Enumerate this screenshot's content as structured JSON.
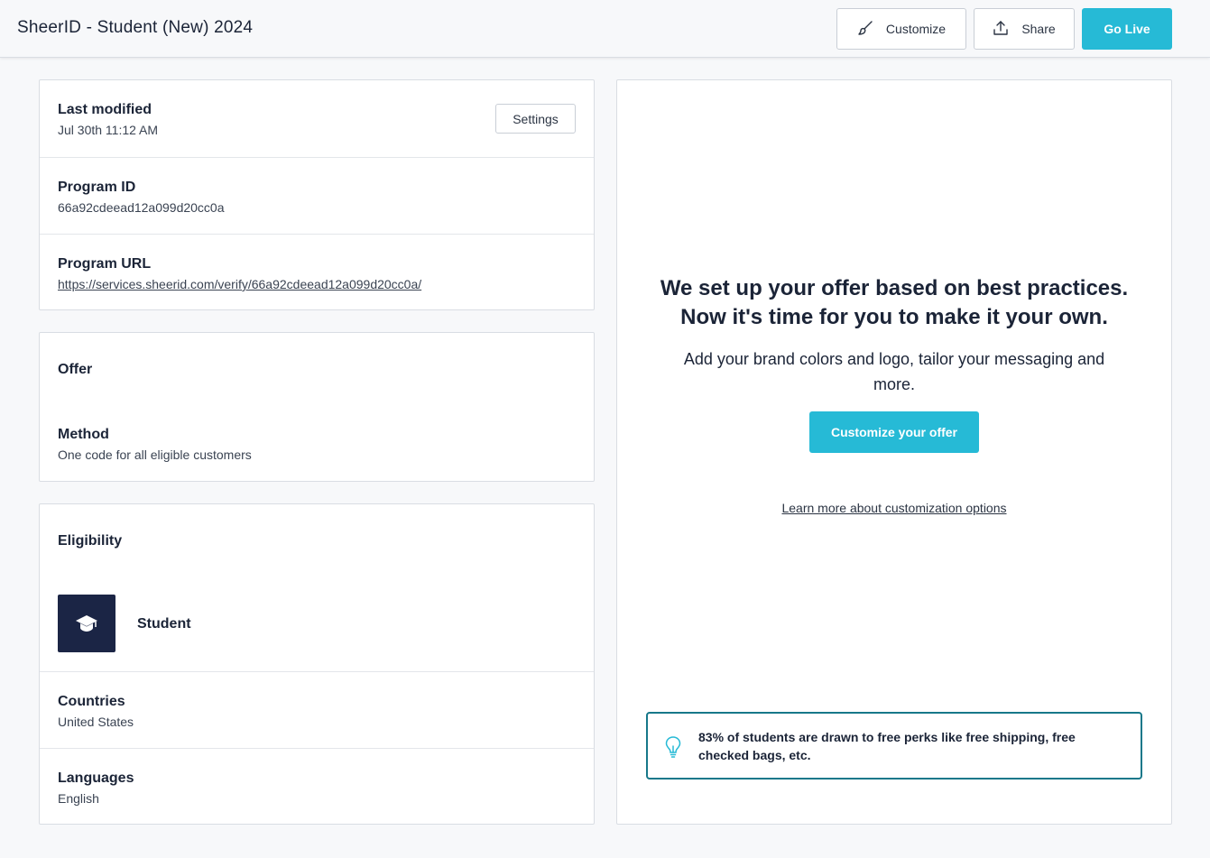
{
  "header": {
    "title": "SheerID - Student (New) 2024",
    "customize_label": "Customize",
    "share_label": "Share",
    "go_live_label": "Go Live"
  },
  "program": {
    "last_modified_label": "Last modified",
    "last_modified_value": "Jul 30th 11:12 AM",
    "settings_label": "Settings",
    "program_id_label": "Program ID",
    "program_id_value": "66a92cdeead12a099d20cc0a",
    "program_url_label": "Program URL",
    "program_url_value": "https://services.sheerid.com/verify/66a92cdeead12a099d20cc0a/"
  },
  "offer": {
    "title": "Offer",
    "method_label": "Method",
    "method_value": "One code for all eligible customers"
  },
  "eligibility": {
    "title": "Eligibility",
    "segment_label": "Student",
    "countries_label": "Countries",
    "countries_value": "United States",
    "languages_label": "Languages",
    "languages_value": "English"
  },
  "preview": {
    "headline_line1": "We set up your offer based on best practices.",
    "headline_line2": "Now it's time for you to make it your own.",
    "subtext": "Add your brand colors and logo, tailor your messaging and more.",
    "cta_label": "Customize your offer",
    "learn_more": "Learn more about customization options",
    "tip_text": "83% of students are drawn to free perks like free shipping, free checked bags, etc."
  },
  "colors": {
    "accent": "#26bad6",
    "tile": "#1b2545",
    "tip_border": "#17788a"
  }
}
